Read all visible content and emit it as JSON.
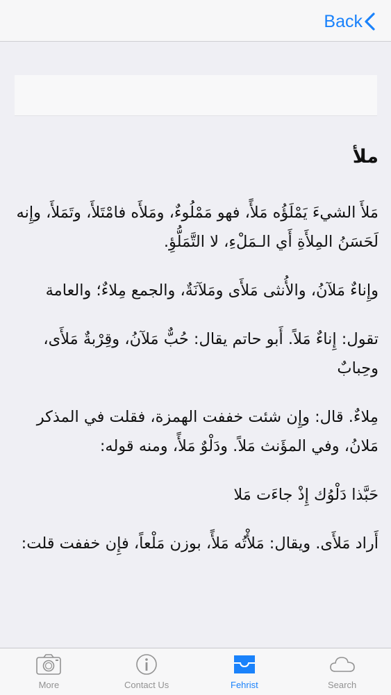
{
  "colors": {
    "accent": "#1a82fb",
    "inactive": "#929292",
    "background": "#efeff4"
  },
  "nav": {
    "back_label": "Back"
  },
  "article": {
    "title": "ملأ",
    "paragraphs": [
      "مَلأَ الشيءَ يَمْلَؤُه مَلأً، فهو مَمْلُوءٌ، ومَلأَه فامْتَلأَ، وتَمَلأَ، وإِنه لَحَسَنُ المِلأَةِ أَي الـمَلْءِ، لا التَّمَلُّؤِ.",
      "وإِناءٌ مَلآنُ، والأُنثى مَلأَى ومَلآنَةٌ، والجمع مِلاءٌ؛ والعامة",
      "تقول: إِناءٌ مَلاً. أَبو حاتم يقال: حُبٌّ مَلآنُ، وقِرْبةٌ مَلأَى، وحِبابٌ",
      "مِلاءٌ. قال: وإِن شئت خففت الهمزة، فقلت في المذكر مَلانُ، وفي المؤَنث مَلاً. ودَلْوٌ مَلأً، ومنه قوله:",
      "حَبَّذا دَلْوُك إِذْ جاءَت مَلا",
      "أَراد مَلأَى. ويقال: مَلأْتُه مَلأً، بوزن مَلْعاً، فإِن خففت قلت:"
    ]
  },
  "tabs": [
    {
      "label": "More",
      "icon": "camera-icon",
      "active": false
    },
    {
      "label": "Contact Us",
      "icon": "info-icon",
      "active": false
    },
    {
      "label": "Fehrist",
      "icon": "inbox-tray-icon",
      "active": true
    },
    {
      "label": "Search",
      "icon": "cloud-icon",
      "active": false
    }
  ]
}
